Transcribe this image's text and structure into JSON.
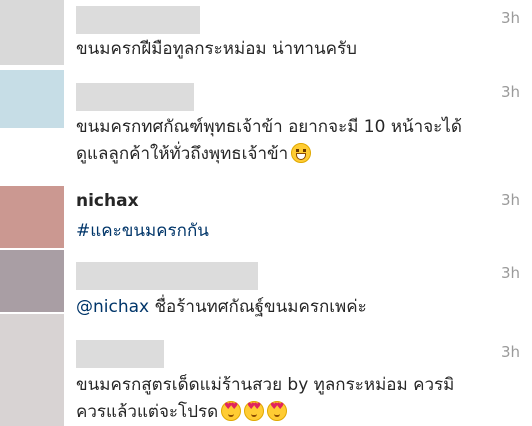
{
  "comments": [
    {
      "username": "",
      "time": "3h",
      "text": "ขนมครกฝีมือทูลกระหม่อม น่าทานครับ",
      "avatar_color": "#d9d9d9"
    },
    {
      "username": "",
      "time": "3h",
      "text_line1": "ขนมครกทศกัณฑ์พุทธเจ้าข้า อยากจะมี 10 หน้าจะได้",
      "text_line2": "ดูแลลูกค้าให้ทั่วถึงพุทธเจ้าข้า",
      "emoji": "grinning-face",
      "avatar_color": "#c6dde6"
    },
    {
      "username": "nichax",
      "time": "3h",
      "text": "#แคะขนมครกกัน",
      "avatar_color": "#cb9891"
    },
    {
      "username": "",
      "time": "3h",
      "mention": "@nichax",
      "text": " ชื่อร้านทศกัณฐ์ขนมครกเพค่ะ",
      "avatar_color": "#a99ea4"
    },
    {
      "username": "",
      "time": "3h",
      "text_line1": "ขนมครกสูตรเด็ดแม่ร้านสวย by ทูลกระหม่อม ควรมิ",
      "text_line2": "ควรแล้วแต่จะโปรด",
      "emoji": "heart-eyes x3",
      "avatar_color": "#d8d3d3"
    }
  ]
}
